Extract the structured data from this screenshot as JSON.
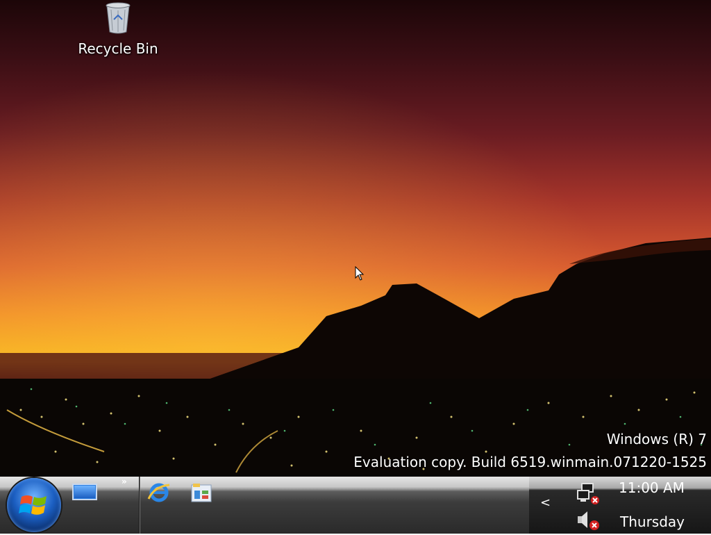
{
  "desktop": {
    "icons": [
      {
        "label": "Recycle Bin",
        "icon": "recycle-bin-icon"
      }
    ],
    "watermark": {
      "line1": "Windows (R) 7",
      "line2": "Evaluation copy. Build 6519.winmain.071220-1525"
    }
  },
  "taskbar": {
    "start_button_icon": "windows-logo-icon",
    "quick_launch": [
      {
        "icon": "show-desktop-icon"
      },
      {
        "icon": "internet-explorer-icon"
      },
      {
        "icon": "windows-explorer-icon"
      }
    ],
    "quick_launch_more": "»",
    "tray": {
      "show_hidden_icons": "<",
      "icons": [
        "network-disconnected-icon",
        "volume-muted-icon"
      ],
      "clock": {
        "time": "11:00 AM",
        "day": "Thursday"
      }
    }
  }
}
